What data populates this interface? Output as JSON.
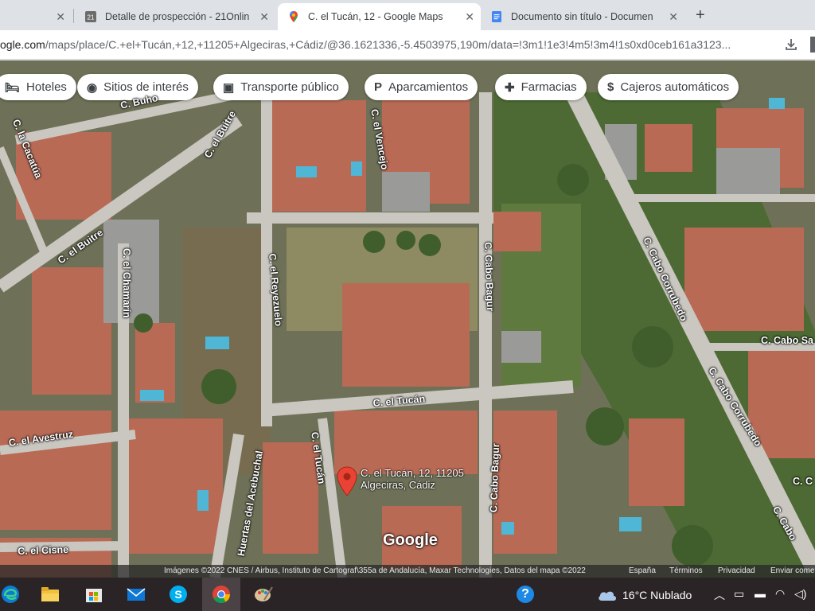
{
  "tabs": [
    {
      "title": "",
      "favicon": "generic-icon"
    },
    {
      "title": "Detalle de prospección - 21Onlin",
      "favicon": "21online-icon"
    },
    {
      "title": "C. el Tucán, 12 - Google Maps",
      "favicon": "google-maps-icon",
      "active": true
    },
    {
      "title": "Documento sin título - Documen",
      "favicon": "google-docs-icon"
    }
  ],
  "address_bar": {
    "url_prefix": "ogle.com",
    "url_rest": "/maps/place/C.+el+Tucán,+12,+11205+Algeciras,+Cádiz/@36.1621336,-5.4503975,190m/data=!3m1!1e3!4m5!3m4!1s0xd0ceb161a3123..."
  },
  "map": {
    "chips": [
      {
        "label": "Hoteles",
        "icon": "bed-icon"
      },
      {
        "label": "Sitios de interés",
        "icon": "camera-icon"
      },
      {
        "label": "Transporte público",
        "icon": "train-icon"
      },
      {
        "label": "Aparcamientos",
        "icon": "parking-icon"
      },
      {
        "label": "Farmacias",
        "icon": "pharmacy-icon"
      },
      {
        "label": "Cajeros automáticos",
        "icon": "atm-icon"
      }
    ],
    "road_labels": {
      "buho": "C. Buho",
      "buitre1": "C. el Buitre",
      "lacacatua": "C. la Cacatúa",
      "buitre2": "C. el Buitre",
      "vencejo": "C. el Vencejo",
      "chamarin": "C. el Chamarín",
      "reyezuelo": "C. el Reyezuelo",
      "cabobagur1": "C. Cabo Bagur",
      "cabocorrubedo1": "C. Cabo Corrubedo",
      "cabosa": "C. Cabo Sa",
      "tucan": "C. el Tucán",
      "cabocorrubedo2": "C. Cabo Corrubedo",
      "avestruz": "C. el Avestruz",
      "tucan_v": "C. el Tucán",
      "acebuchal": "Huertas del Acebuchal",
      "cabobagur2": "C. Cabo Bagur",
      "cisne": "C. el Cisne",
      "c_right": "C. C",
      "cabo_right": "C. Cabo"
    },
    "pin_label_line1": "C. el Tucán, 12, 11205",
    "pin_label_line2": "Algeciras, Cádiz",
    "logo": "Google",
    "attribution": "Imágenes ©2022 CNES / Airbus, Instituto de Cartograf\\355a de Andalucía, Maxar Technologies, Datos del mapa ©2022",
    "footer_links": [
      "España",
      "Términos",
      "Privacidad",
      "Enviar come"
    ]
  },
  "taskbar": {
    "apps": [
      "edge-icon",
      "file-explorer-icon",
      "store-icon",
      "mail-icon",
      "skype-icon",
      "chrome-icon",
      "paint-icon"
    ],
    "weather": "16°C  Nublado"
  }
}
